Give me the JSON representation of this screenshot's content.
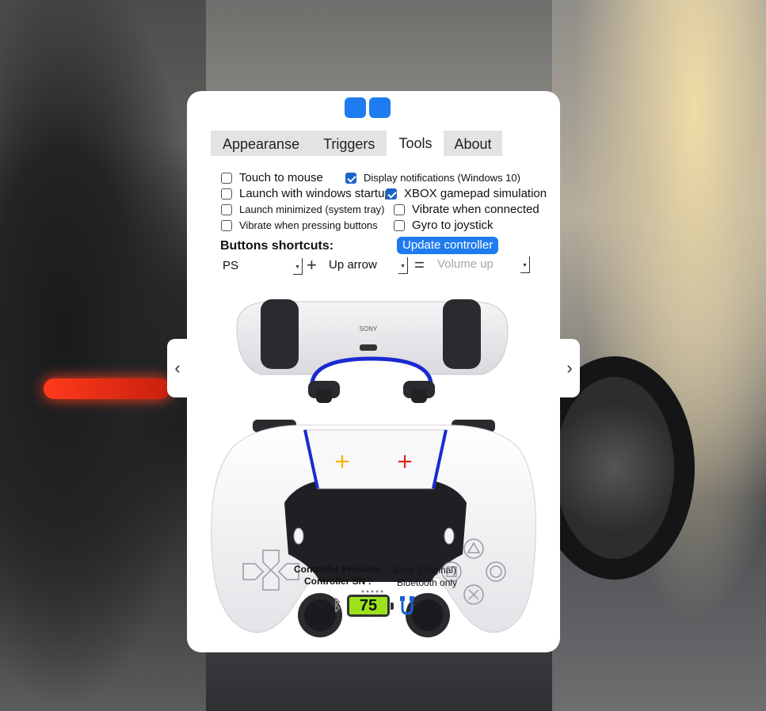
{
  "tabs": [
    "Appearanse",
    "Triggers",
    "Tools",
    "About"
  ],
  "active_tab": "Tools",
  "options": {
    "touch_to_mouse": {
      "label": "Touch to mouse",
      "checked": false
    },
    "display_notifications": {
      "label": "Display notifications (Windows 10)",
      "checked": true
    },
    "launch_with_windows": {
      "label": "Launch with windows startup",
      "checked": false
    },
    "xbox_simulation": {
      "label": "XBOX gamepad simulation",
      "checked": true
    },
    "launch_minimized": {
      "label": "Launch minimized (system tray)",
      "checked": false
    },
    "vibrate_connected": {
      "label": "Vibrate when connected",
      "checked": false
    },
    "vibrate_buttons": {
      "label": "Vibrate when pressing buttons",
      "checked": false
    },
    "gyro_joystick": {
      "label": "Gyro to joystick",
      "checked": false
    }
  },
  "shortcuts": {
    "title": "Buttons shortcuts:",
    "update_button": "Update controller",
    "button1": "PS",
    "plus": "+",
    "button2": "Up arrow",
    "equals": "=",
    "action": "Volume up"
  },
  "controller_info": {
    "provider_label": "Controller Provider:",
    "provider_value": "Sony (Original)",
    "sn_label": "Controller SN :",
    "sn_value": "Bluetooth only"
  },
  "battery": {
    "level": "75",
    "fill_color": "#9be21b"
  },
  "colors": {
    "accent": "#1f7cf0",
    "lightbar": "#1a2ad0",
    "touchpad_plus_left": "#f2b400",
    "touchpad_plus_right": "#e02010"
  },
  "icons": {
    "nav_left": "‹",
    "nav_right": "›",
    "bluetooth": "ᛒ"
  }
}
